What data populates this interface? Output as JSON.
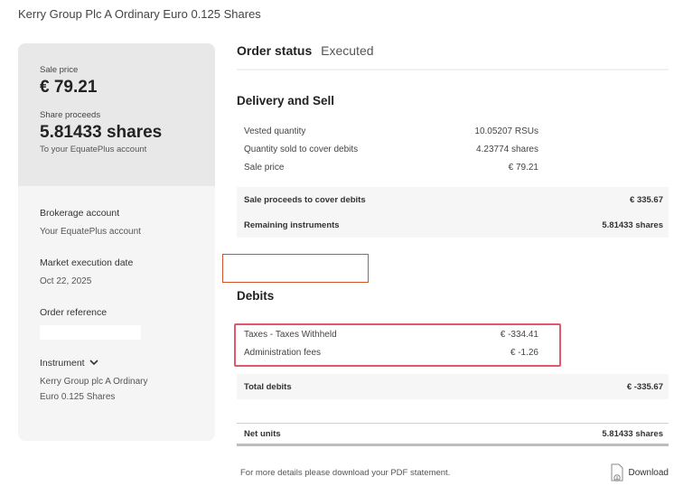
{
  "page": {
    "title": "Kerry Group Plc A Ordinary Euro 0.125 Shares"
  },
  "left_card": {
    "sale_price_label": "Sale price",
    "sale_price_value": "€ 79.21",
    "share_proceeds_label": "Share proceeds",
    "share_proceeds_value": "5.81433 shares",
    "share_proceeds_note": "To your EquatePlus account",
    "brokerage_label": "Brokerage account",
    "brokerage_value": "Your EquatePlus account",
    "market_date_label": "Market execution date",
    "market_date_value": "Oct 22, 2025",
    "order_ref_label": "Order reference",
    "instrument_label": "Instrument",
    "instrument_value_line1": "Kerry Group plc A Ordinary",
    "instrument_value_line2": "Euro 0.125 Shares"
  },
  "order_status": {
    "label": "Order status",
    "value": "Executed"
  },
  "delivery": {
    "title": "Delivery and Sell",
    "rows": [
      {
        "label": "Vested quantity",
        "value": "10.05207 RSUs"
      },
      {
        "label": "Quantity sold to cover debits",
        "value": "4.23774 shares"
      },
      {
        "label": "Sale price",
        "value": "€ 79.21"
      }
    ],
    "sale_proceeds_label": "Sale proceeds to cover debits",
    "sale_proceeds_value": "€ 335.67",
    "remaining_label": "Remaining instruments",
    "remaining_value": "5.81433 shares"
  },
  "debits": {
    "title": "Debits",
    "rows": [
      {
        "label": "Taxes - Taxes Withheld",
        "value": "€ -334.41"
      },
      {
        "label": "Administration fees",
        "value": "€ -1.26"
      }
    ],
    "total_label": "Total debits",
    "total_value": "€ -335.67"
  },
  "net": {
    "label": "Net units",
    "value": "5.81433 shares"
  },
  "footer": {
    "note": "For more details please download your PDF statement.",
    "download_label": "Download"
  },
  "colors": {
    "highlight_red": "#e0596a",
    "empty_box_orange": "#d1542b"
  }
}
